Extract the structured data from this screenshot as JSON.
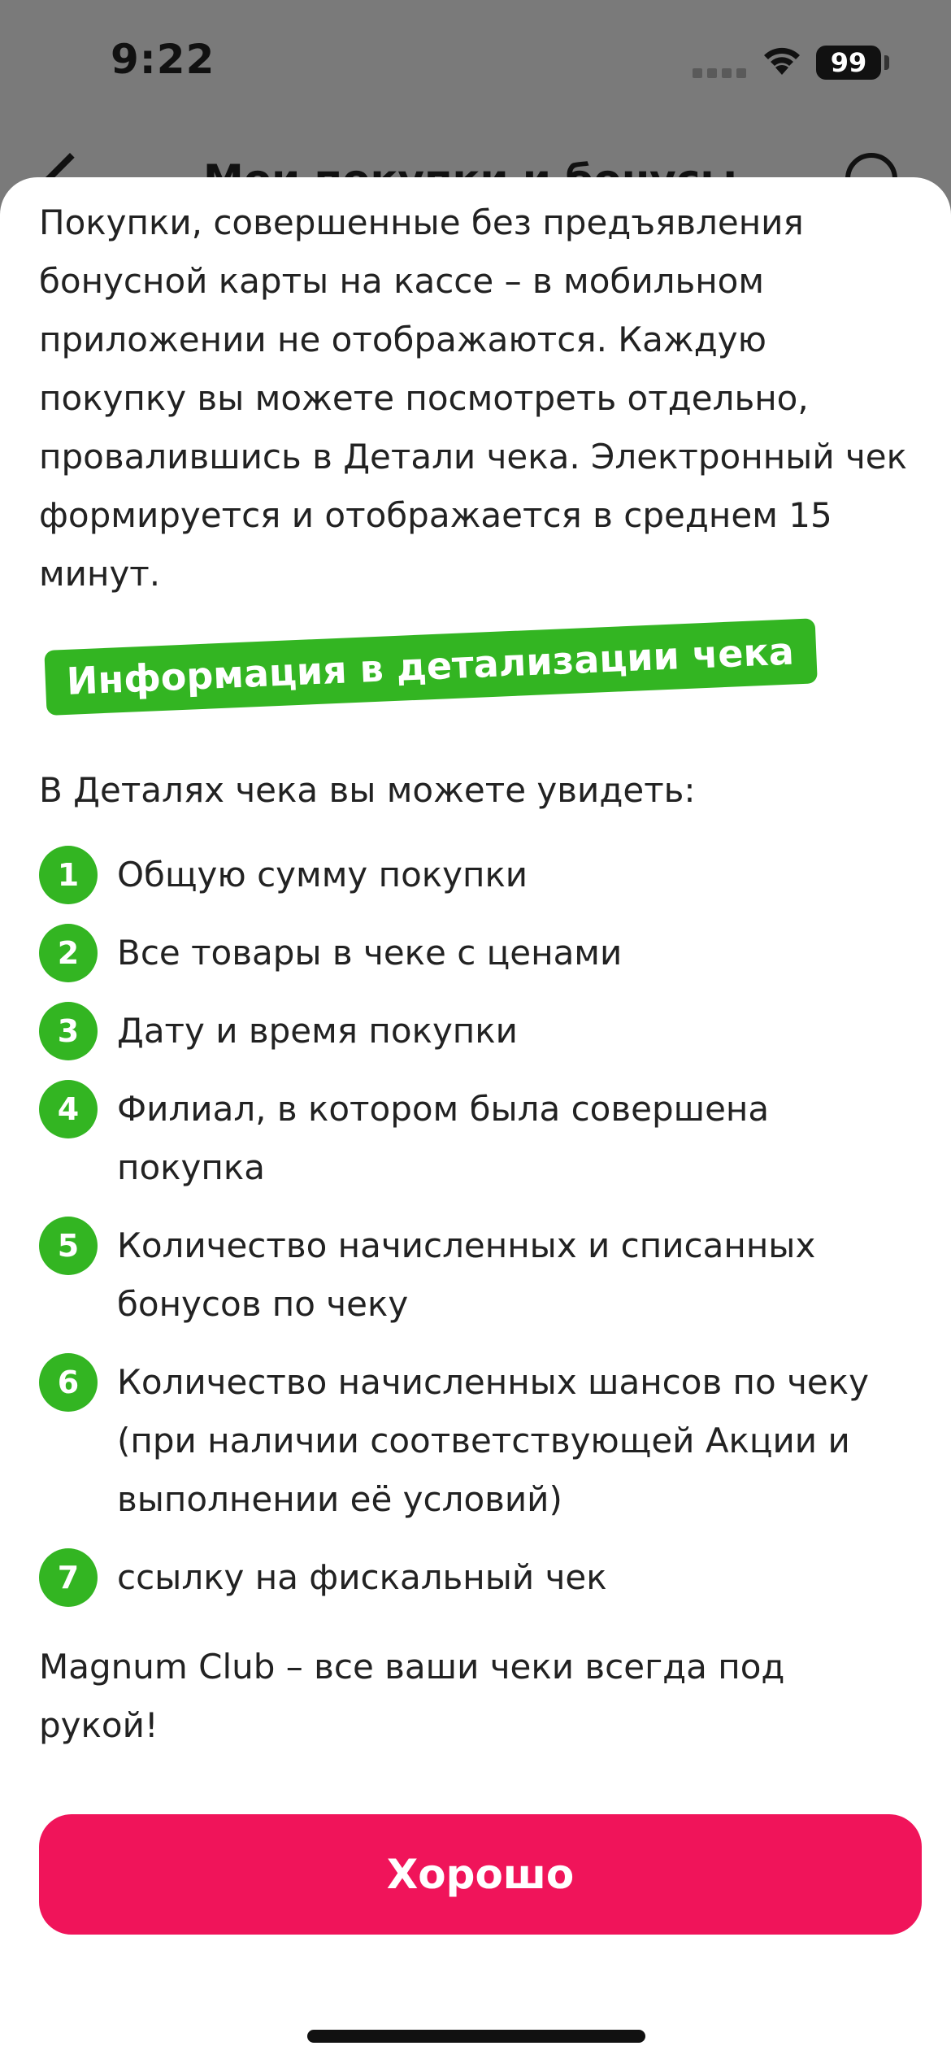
{
  "status_bar": {
    "time": "9:22",
    "battery": "99"
  },
  "underlying_nav": {
    "title": "Мои покупки и бонусы"
  },
  "sheet": {
    "intro_paragraph": "Покупки, совершенные без предъявления бонусной карты на кассе – в мобильном приложении не отображаются. Каждую покупку вы можете посмотреть отдельно, провалившись в Детали чека. Электронный чек формируется и отображается в среднем 15 минут.",
    "section_tag": "Информация в детализации чека",
    "list_intro": "В Деталях чека вы можете увидеть:",
    "items": [
      {
        "num": "1",
        "text": "Общую сумму покупки"
      },
      {
        "num": "2",
        "text": "Все товары в чеке с ценами"
      },
      {
        "num": "3",
        "text": "Дату и время покупки"
      },
      {
        "num": "4",
        "text": "Филиал, в котором была совершена покупка"
      },
      {
        "num": "5",
        "text": "Количество начисленных и списанных бонусов по чеку"
      },
      {
        "num": "6",
        "text": "Количество начисленных шансов по чеку (при наличии соответствующей Акции и выполнении её условий)"
      },
      {
        "num": "7",
        "text": "ссылку на фискальный чек"
      }
    ],
    "outro": "Magnum Club – все ваши чеки всегда под рукой!",
    "ok_label": "Хорошо"
  },
  "colors": {
    "accent_green": "#33b522",
    "button_pink": "#f0145a",
    "overlay_gray": "#7a7a7a"
  }
}
